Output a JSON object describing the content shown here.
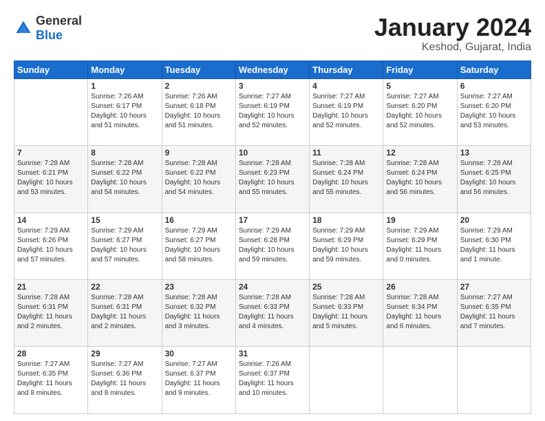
{
  "header": {
    "logo_general": "General",
    "logo_blue": "Blue",
    "month_title": "January 2024",
    "location": "Keshod, Gujarat, India"
  },
  "days_of_week": [
    "Sunday",
    "Monday",
    "Tuesday",
    "Wednesday",
    "Thursday",
    "Friday",
    "Saturday"
  ],
  "weeks": [
    [
      {
        "day": "",
        "sunrise": "",
        "sunset": "",
        "daylight": "",
        "empty": true
      },
      {
        "day": "1",
        "sunrise": "Sunrise: 7:26 AM",
        "sunset": "Sunset: 6:17 PM",
        "daylight": "Daylight: 10 hours and 51 minutes.",
        "empty": false
      },
      {
        "day": "2",
        "sunrise": "Sunrise: 7:26 AM",
        "sunset": "Sunset: 6:18 PM",
        "daylight": "Daylight: 10 hours and 51 minutes.",
        "empty": false
      },
      {
        "day": "3",
        "sunrise": "Sunrise: 7:27 AM",
        "sunset": "Sunset: 6:19 PM",
        "daylight": "Daylight: 10 hours and 52 minutes.",
        "empty": false
      },
      {
        "day": "4",
        "sunrise": "Sunrise: 7:27 AM",
        "sunset": "Sunset: 6:19 PM",
        "daylight": "Daylight: 10 hours and 52 minutes.",
        "empty": false
      },
      {
        "day": "5",
        "sunrise": "Sunrise: 7:27 AM",
        "sunset": "Sunset: 6:20 PM",
        "daylight": "Daylight: 10 hours and 52 minutes.",
        "empty": false
      },
      {
        "day": "6",
        "sunrise": "Sunrise: 7:27 AM",
        "sunset": "Sunset: 6:20 PM",
        "daylight": "Daylight: 10 hours and 53 minutes.",
        "empty": false
      }
    ],
    [
      {
        "day": "7",
        "sunrise": "Sunrise: 7:28 AM",
        "sunset": "Sunset: 6:21 PM",
        "daylight": "Daylight: 10 hours and 53 minutes.",
        "empty": false
      },
      {
        "day": "8",
        "sunrise": "Sunrise: 7:28 AM",
        "sunset": "Sunset: 6:22 PM",
        "daylight": "Daylight: 10 hours and 54 minutes.",
        "empty": false
      },
      {
        "day": "9",
        "sunrise": "Sunrise: 7:28 AM",
        "sunset": "Sunset: 6:22 PM",
        "daylight": "Daylight: 10 hours and 54 minutes.",
        "empty": false
      },
      {
        "day": "10",
        "sunrise": "Sunrise: 7:28 AM",
        "sunset": "Sunset: 6:23 PM",
        "daylight": "Daylight: 10 hours and 55 minutes.",
        "empty": false
      },
      {
        "day": "11",
        "sunrise": "Sunrise: 7:28 AM",
        "sunset": "Sunset: 6:24 PM",
        "daylight": "Daylight: 10 hours and 55 minutes.",
        "empty": false
      },
      {
        "day": "12",
        "sunrise": "Sunrise: 7:28 AM",
        "sunset": "Sunset: 6:24 PM",
        "daylight": "Daylight: 10 hours and 56 minutes.",
        "empty": false
      },
      {
        "day": "13",
        "sunrise": "Sunrise: 7:28 AM",
        "sunset": "Sunset: 6:25 PM",
        "daylight": "Daylight: 10 hours and 56 minutes.",
        "empty": false
      }
    ],
    [
      {
        "day": "14",
        "sunrise": "Sunrise: 7:29 AM",
        "sunset": "Sunset: 6:26 PM",
        "daylight": "Daylight: 10 hours and 57 minutes.",
        "empty": false
      },
      {
        "day": "15",
        "sunrise": "Sunrise: 7:29 AM",
        "sunset": "Sunset: 6:27 PM",
        "daylight": "Daylight: 10 hours and 57 minutes.",
        "empty": false
      },
      {
        "day": "16",
        "sunrise": "Sunrise: 7:29 AM",
        "sunset": "Sunset: 6:27 PM",
        "daylight": "Daylight: 10 hours and 58 minutes.",
        "empty": false
      },
      {
        "day": "17",
        "sunrise": "Sunrise: 7:29 AM",
        "sunset": "Sunset: 6:28 PM",
        "daylight": "Daylight: 10 hours and 59 minutes.",
        "empty": false
      },
      {
        "day": "18",
        "sunrise": "Sunrise: 7:29 AM",
        "sunset": "Sunset: 6:29 PM",
        "daylight": "Daylight: 10 hours and 59 minutes.",
        "empty": false
      },
      {
        "day": "19",
        "sunrise": "Sunrise: 7:29 AM",
        "sunset": "Sunset: 6:29 PM",
        "daylight": "Daylight: 11 hours and 0 minutes.",
        "empty": false
      },
      {
        "day": "20",
        "sunrise": "Sunrise: 7:29 AM",
        "sunset": "Sunset: 6:30 PM",
        "daylight": "Daylight: 11 hours and 1 minute.",
        "empty": false
      }
    ],
    [
      {
        "day": "21",
        "sunrise": "Sunrise: 7:28 AM",
        "sunset": "Sunset: 6:31 PM",
        "daylight": "Daylight: 11 hours and 2 minutes.",
        "empty": false
      },
      {
        "day": "22",
        "sunrise": "Sunrise: 7:28 AM",
        "sunset": "Sunset: 6:31 PM",
        "daylight": "Daylight: 11 hours and 2 minutes.",
        "empty": false
      },
      {
        "day": "23",
        "sunrise": "Sunrise: 7:28 AM",
        "sunset": "Sunset: 6:32 PM",
        "daylight": "Daylight: 11 hours and 3 minutes.",
        "empty": false
      },
      {
        "day": "24",
        "sunrise": "Sunrise: 7:28 AM",
        "sunset": "Sunset: 6:33 PM",
        "daylight": "Daylight: 11 hours and 4 minutes.",
        "empty": false
      },
      {
        "day": "25",
        "sunrise": "Sunrise: 7:28 AM",
        "sunset": "Sunset: 6:33 PM",
        "daylight": "Daylight: 11 hours and 5 minutes.",
        "empty": false
      },
      {
        "day": "26",
        "sunrise": "Sunrise: 7:28 AM",
        "sunset": "Sunset: 6:34 PM",
        "daylight": "Daylight: 11 hours and 6 minutes.",
        "empty": false
      },
      {
        "day": "27",
        "sunrise": "Sunrise: 7:27 AM",
        "sunset": "Sunset: 6:35 PM",
        "daylight": "Daylight: 11 hours and 7 minutes.",
        "empty": false
      }
    ],
    [
      {
        "day": "28",
        "sunrise": "Sunrise: 7:27 AM",
        "sunset": "Sunset: 6:35 PM",
        "daylight": "Daylight: 11 hours and 8 minutes.",
        "empty": false
      },
      {
        "day": "29",
        "sunrise": "Sunrise: 7:27 AM",
        "sunset": "Sunset: 6:36 PM",
        "daylight": "Daylight: 11 hours and 8 minutes.",
        "empty": false
      },
      {
        "day": "30",
        "sunrise": "Sunrise: 7:27 AM",
        "sunset": "Sunset: 6:37 PM",
        "daylight": "Daylight: 11 hours and 9 minutes.",
        "empty": false
      },
      {
        "day": "31",
        "sunrise": "Sunrise: 7:26 AM",
        "sunset": "Sunset: 6:37 PM",
        "daylight": "Daylight: 11 hours and 10 minutes.",
        "empty": false
      },
      {
        "day": "",
        "sunrise": "",
        "sunset": "",
        "daylight": "",
        "empty": true
      },
      {
        "day": "",
        "sunrise": "",
        "sunset": "",
        "daylight": "",
        "empty": true
      },
      {
        "day": "",
        "sunrise": "",
        "sunset": "",
        "daylight": "",
        "empty": true
      }
    ]
  ]
}
